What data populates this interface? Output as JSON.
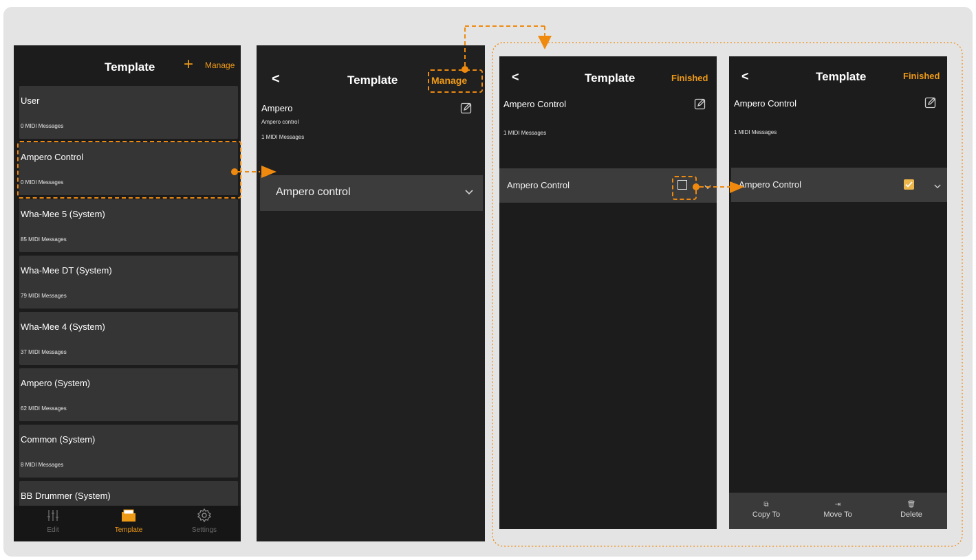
{
  "colors": {
    "accent": "#ef9a17",
    "panel_bg": "#1c1c1c",
    "card_bg": "#353535",
    "arrow": "#ef8a0f"
  },
  "screen1": {
    "title": "Template",
    "add_icon": "plus-icon",
    "manage": "Manage",
    "templates": [
      {
        "name": "User",
        "count": "0 MIDI Messages"
      },
      {
        "name": "Ampero Control",
        "count": "0 MIDI Messages"
      },
      {
        "name": "Wha-Mee 5 (System)",
        "count": "85 MIDI Messages"
      },
      {
        "name": "Wha-Mee DT (System)",
        "count": "79 MIDI Messages"
      },
      {
        "name": "Wha-Mee 4 (System)",
        "count": "37 MIDI Messages"
      },
      {
        "name": "Ampero (System)",
        "count": "62 MIDI Messages"
      },
      {
        "name": "Common (System)",
        "count": "8 MIDI Messages"
      },
      {
        "name": "BB Drummer (System)",
        "count": ""
      }
    ],
    "tabs": [
      {
        "label": "Edit",
        "icon": "sliders-icon"
      },
      {
        "label": "Template",
        "icon": "folder-icon"
      },
      {
        "label": "Settings",
        "icon": "gear-icon"
      }
    ]
  },
  "screen2": {
    "back": "<",
    "title": "Template",
    "manage": "Manage",
    "name": "Ampero",
    "description": "Ampero control",
    "count": "1 MIDI Messages",
    "row": "Ampero control"
  },
  "screen3": {
    "back": "<",
    "title": "Template",
    "finished": "Finished",
    "name": "Ampero Control",
    "count": "1 MIDI Messages",
    "row": "Ampero Control",
    "checked": false
  },
  "screen4": {
    "back": "<",
    "title": "Template",
    "finished": "Finished",
    "name": "Ampero Control",
    "count": "1 MIDI Messages",
    "row": "Ampero Control",
    "checked": true,
    "actions": [
      {
        "label": "Copy To",
        "icon": "copy-icon"
      },
      {
        "label": "Move To",
        "icon": "move-icon"
      },
      {
        "label": "Delete",
        "icon": "trash-icon"
      }
    ]
  }
}
